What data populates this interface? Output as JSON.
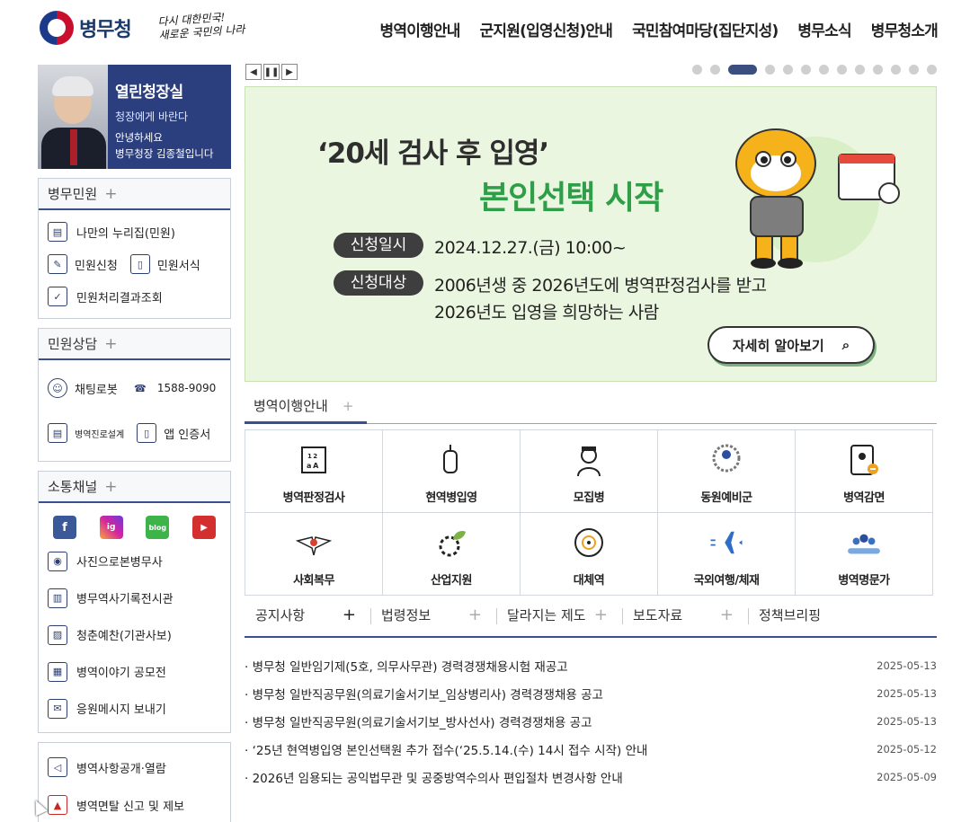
{
  "header": {
    "logo_text": "병무청",
    "slogan_line1": "다시 대한민국!",
    "slogan_line2": "새로운 국민의 나라",
    "nav": [
      "병역이행안내",
      "군지원(입영신청)안내",
      "국민참여마당(집단지성)",
      "병무소식",
      "병무청소개"
    ]
  },
  "ceo_card": {
    "title": "열린청장실",
    "subtitle": "청장에게 바란다",
    "msg1": "안녕하세요",
    "msg2": "병무청장 김종철입니다"
  },
  "civil": {
    "title": "병무민원",
    "items": [
      "나만의 누리집(민원)",
      "민원신청",
      "민원서식",
      "민원처리결과조회"
    ]
  },
  "consult": {
    "title": "민원상담",
    "items": [
      "채팅로봇",
      "1588-9090",
      "병역진로설계",
      "앱 인증서"
    ]
  },
  "channel": {
    "title": "소통채널",
    "sns": [
      "f",
      "ig",
      "blog",
      "▶"
    ],
    "items": [
      "사진으로본병무사",
      "병무역사기록전시관",
      "청춘예찬(기관사보)",
      "병역이야기 공모전",
      "응원메시지 보내기"
    ]
  },
  "extra": {
    "items": [
      "병역사항공개·열람",
      "병역면탈 신고 및 제보"
    ]
  },
  "banner": {
    "line1": "‘20세 검사 후 입영’",
    "line2": "본인선택 시작",
    "chip1": "신청일시",
    "text1": "2024.12.27.(금) 10:00~",
    "chip2": "신청대상",
    "text2a": "2006년생 중 2026년도에 병역판정검사를 받고",
    "text2b": "2026년도 입영을 희망하는 사람",
    "more": "자세히 알아보기",
    "slide_count": 13,
    "active_slide": 3
  },
  "guide": {
    "title": "병역이행안내",
    "items": [
      "병역판정검사",
      "현역병입영",
      "모집병",
      "동원예비군",
      "병역감면",
      "사회복무",
      "산업지원",
      "대체역",
      "국외여행/체재",
      "병역명문가"
    ]
  },
  "notice": {
    "tabs": [
      "공지사항",
      "법령정보",
      "달라지는 제도",
      "보도자료",
      "정책브리핑"
    ],
    "items": [
      {
        "title": "병무청 일반임기제(5호, 의무사무관) 경력경쟁채용시험 재공고",
        "date": "2025-05-13"
      },
      {
        "title": "병무청 일반직공무원(의료기술서기보_임상병리사) 경력경쟁채용 공고",
        "date": "2025-05-13"
      },
      {
        "title": "병무청 일반직공무원(의료기술서기보_방사선사) 경력경쟁채용 공고",
        "date": "2025-05-13"
      },
      {
        "title": "‘25년 현역병입영 본인선택원 추가 접수(‘25.5.14.(수) 14시 접수 시작) 안내",
        "date": "2025-05-12"
      },
      {
        "title": "2026년 임용되는 공익법무관 및 공중방역수의사 편입절차 변경사항 안내",
        "date": "2025-05-09"
      }
    ]
  }
}
